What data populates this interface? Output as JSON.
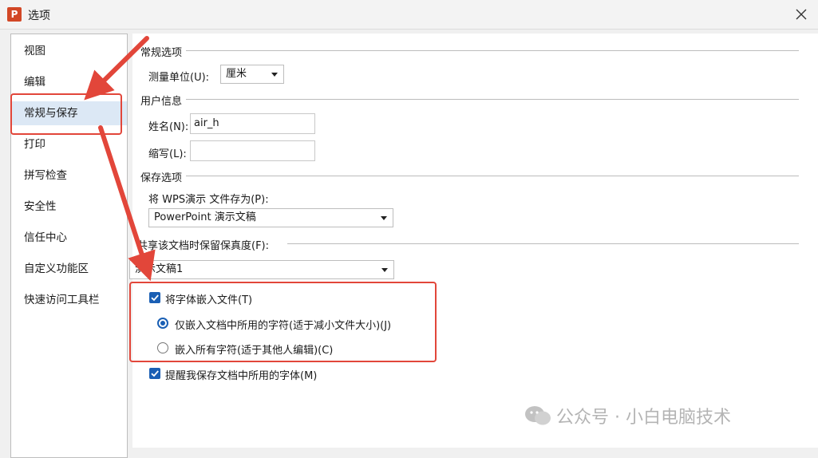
{
  "window": {
    "title": "选项",
    "icon_letter": "P"
  },
  "sidebar": {
    "items": [
      {
        "label": "视图"
      },
      {
        "label": "编辑"
      },
      {
        "label": "常规与保存",
        "selected": true
      },
      {
        "label": "打印"
      },
      {
        "label": "拼写检查"
      },
      {
        "label": "安全性"
      },
      {
        "label": "信任中心"
      },
      {
        "label": "自定义功能区"
      },
      {
        "label": "快速访问工具栏"
      }
    ]
  },
  "general": {
    "section_title": "常规选项",
    "unit_label": "测量单位(U):",
    "unit_value": "厘米"
  },
  "user_info": {
    "section_title": "用户信息",
    "name_label": "姓名(N):",
    "name_value": "air_h",
    "initials_label": "缩写(L):",
    "initials_value": ""
  },
  "save": {
    "section_title": "保存选项",
    "save_as_label": "将 WPS演示 文件存为(P):",
    "save_as_value": "PowerPoint 演示文稿"
  },
  "fidelity": {
    "section_title": "共享该文档时保留保真度(F):",
    "doc_value": "演示文稿1",
    "embed_fonts": {
      "label": "将字体嵌入文件(T)",
      "checked": true
    },
    "embed_used_only": {
      "label": "仅嵌入文档中所用的字符(适于减小文件大小)(J)",
      "selected": true
    },
    "embed_all": {
      "label": "嵌入所有字符(适于其他人编辑)(C)",
      "selected": false
    },
    "remind_fonts": {
      "label": "提醒我保存文档中所用的字体(M)",
      "checked": true
    }
  },
  "watermark": {
    "text": "公众号 · 小白电脑技术"
  },
  "colors": {
    "accent": "#1a5fb4",
    "annotation_red": "#e2463a",
    "brand": "#d24726"
  }
}
